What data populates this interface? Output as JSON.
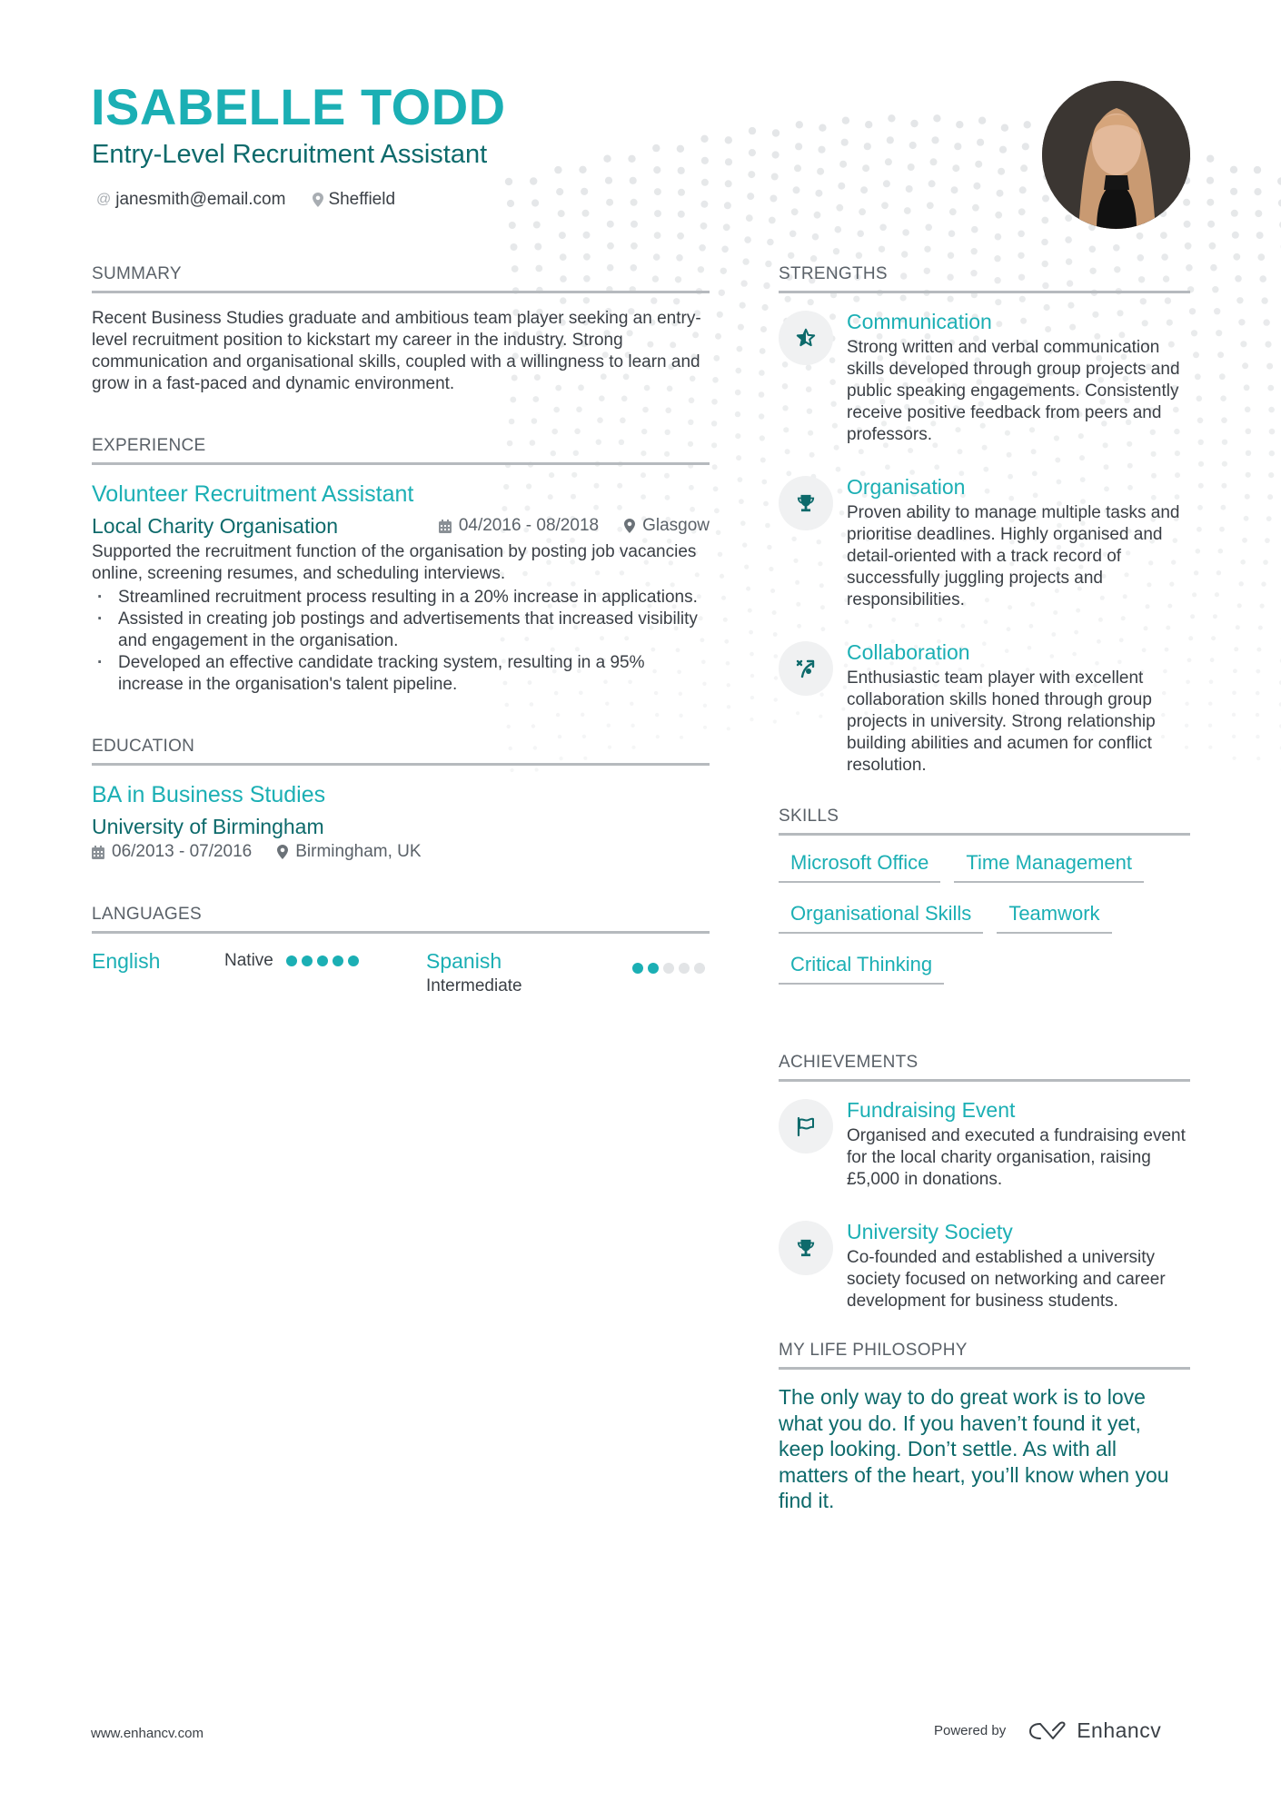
{
  "header": {
    "name": "ISABELLE TODD",
    "title": "Entry-Level Recruitment Assistant",
    "email": "janesmith@email.com",
    "location": "Sheffield",
    "email_icon": "at-icon",
    "location_icon": "map-pin-icon",
    "photo_alt": "profile-photo"
  },
  "summary": {
    "heading": "SUMMARY",
    "text": "Recent Business Studies graduate and ambitious team player seeking an entry-level recruitment position to kickstart my career in the industry. Strong communication and organisational skills, coupled with a willingness to learn and grow in a fast-paced and dynamic environment."
  },
  "experience": {
    "heading": "EXPERIENCE",
    "items": [
      {
        "title": "Volunteer Recruitment Assistant",
        "company": "Local Charity Organisation",
        "dates": "04/2016 - 08/2018",
        "location": "Glasgow",
        "description": "Supported the recruitment function of the organisation by posting job vacancies online, screening resumes, and scheduling interviews.",
        "bullets": [
          "Streamlined recruitment process resulting in a 20% increase in applications.",
          "Assisted in creating job postings and advertisements that increased visibility and engagement in the organisation.",
          "Developed an effective candidate tracking system, resulting in a 95% increase in the organisation's talent pipeline."
        ]
      }
    ]
  },
  "education": {
    "heading": "EDUCATION",
    "items": [
      {
        "degree": "BA in Business Studies",
        "school": "University of Birmingham",
        "dates": "06/2013 - 07/2016",
        "location": "Birmingham, UK"
      }
    ]
  },
  "languages": {
    "heading": "LANGUAGES",
    "items": [
      {
        "name": "English",
        "level": "Native",
        "rating": 5,
        "max": 5
      },
      {
        "name": "Spanish",
        "level": "Intermediate",
        "rating": 2,
        "max": 5
      }
    ]
  },
  "strengths": {
    "heading": "STRENGTHS",
    "items": [
      {
        "icon": "star-icon",
        "title": "Communication",
        "description": "Strong written and verbal communication skills developed through group projects and public speaking engagements. Consistently receive positive feedback from peers and professors."
      },
      {
        "icon": "trophy-icon",
        "title": "Organisation",
        "description": "Proven ability to manage multiple tasks and prioritise deadlines. Highly organised and detail-oriented with a track record of successfully juggling projects and responsibilities."
      },
      {
        "icon": "strategy-icon",
        "title": "Collaboration",
        "description": "Enthusiastic team player with excellent collaboration skills honed through group projects in university. Strong relationship building abilities and acumen for conflict resolution."
      }
    ]
  },
  "skills": {
    "heading": "SKILLS",
    "items": [
      "Microsoft Office",
      "Time Management",
      "Organisational Skills",
      "Teamwork",
      "Critical Thinking"
    ]
  },
  "achievements": {
    "heading": "ACHIEVEMENTS",
    "items": [
      {
        "icon": "flag-icon",
        "title": "Fundraising Event",
        "description": "Organised and executed a fundraising event for the local charity organisation, raising £5,000 in donations."
      },
      {
        "icon": "trophy-icon",
        "title": "University Society",
        "description": "Co-founded and established a university society focused on networking and career development for business students."
      }
    ]
  },
  "philosophy": {
    "heading": "MY LIFE PHILOSOPHY",
    "quote": "The only way to do great work is to love what you do. If you haven’t found it yet, keep looking. Don’t settle. As with all matters of the heart, you’ll know when you find it."
  },
  "footer": {
    "website": "www.enhancv.com",
    "powered_by": "Powered by",
    "brand": "Enhancv"
  },
  "colors": {
    "accent": "#1bafb4",
    "accent_dark": "#0d6a6b",
    "text": "#3a3f45",
    "rule": "#b6babe",
    "icon_bg": "#f0f1f2"
  }
}
